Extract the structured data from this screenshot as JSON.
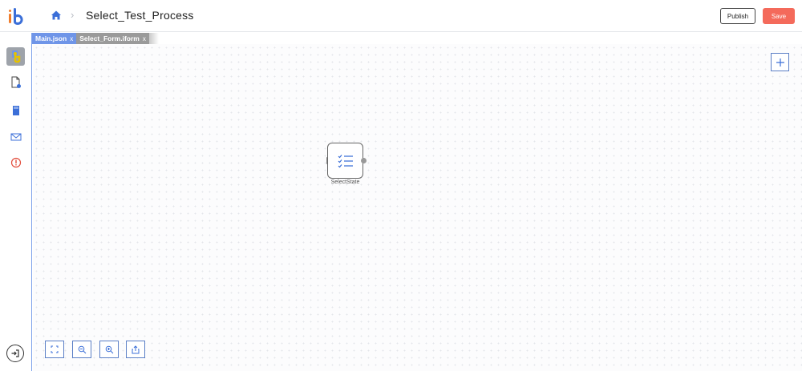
{
  "app": {
    "logo_icon": "ib-logo",
    "brand_colors": {
      "primary": "#3b6fd8",
      "accent": "#f07d2c"
    }
  },
  "header": {
    "home_icon": "home-icon",
    "breadcrumb_separator": "›",
    "title": "Select_Test_Process",
    "publish_label": "Publish",
    "save_label": "Save",
    "save_color": "#f46a5b"
  },
  "sidebar": {
    "items": [
      {
        "name": "process-icon",
        "active": true
      },
      {
        "name": "document-icon",
        "active": false
      },
      {
        "name": "storage-icon",
        "active": false
      },
      {
        "name": "mail-icon",
        "active": false
      },
      {
        "name": "alert-icon",
        "active": false
      }
    ],
    "exit_icon": "exit-icon"
  },
  "tabs": [
    {
      "label": "Main.json",
      "close": "x",
      "active": true
    },
    {
      "label": "Select_Form.iform",
      "close": "x",
      "active": false
    }
  ],
  "canvas": {
    "add_icon": "plus-icon",
    "node": {
      "label": "SelectState",
      "icon": "checklist-icon"
    },
    "controls": [
      {
        "name": "fit-screen-icon"
      },
      {
        "name": "zoom-out-icon"
      },
      {
        "name": "zoom-in-icon"
      },
      {
        "name": "export-icon"
      }
    ]
  }
}
